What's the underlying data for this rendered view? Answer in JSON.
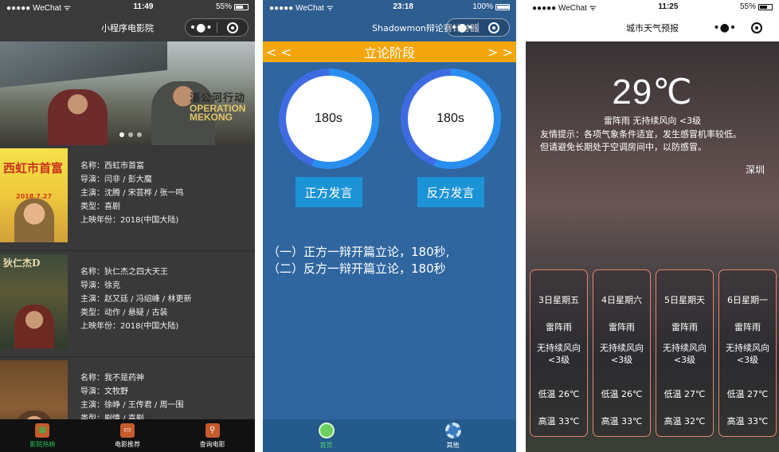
{
  "phone1": {
    "status": {
      "carrier": "●●●●● WeChat ᯤ",
      "time": "11:49",
      "battery": "55%"
    },
    "nav_title": "小程序电影院",
    "banner": {
      "title_cn": "湄公河行动",
      "title_en": "OPERATION MEKONG"
    },
    "movies": [
      {
        "poster_title": "西虹市首富",
        "poster_date": "2018.7.27",
        "name": "名称：西虹市首富",
        "director": "导演：闫非 / 彭大魔",
        "cast": "主演：沈腾 / 宋芸桦 / 张一鸣",
        "genre": "类型：喜剧",
        "year": "上映年份：2018(中国大陆)"
      },
      {
        "poster_title": "狄仁杰D",
        "poster_date": "",
        "name": "名称：狄仁杰之四大天王",
        "director": "导演：徐克",
        "cast": "主演：赵又廷 / 冯绍峰 / 林更新",
        "genre": "类型：动作 / 悬疑 / 古装",
        "year": "上映年份：2018(中国大陆)"
      },
      {
        "poster_title": "",
        "poster_date": "",
        "name": "名称：我不是药神",
        "director": "导演：文牧野",
        "cast": "主演：徐峥 / 王传君 / 周一围",
        "genre": "类型：剧情 / 喜剧",
        "year": ""
      }
    ],
    "tabs": [
      "影院热映",
      "电影推荐",
      "查询电影"
    ]
  },
  "phone2": {
    "status": {
      "carrier": "●●●●● WeChat ᯤ",
      "time": "23:18",
      "battery": "100%"
    },
    "nav_title": "Shadowmon辩论赛计时器",
    "stage": {
      "prev": "< <",
      "title": "立论阶段",
      "next": "> >"
    },
    "timers": [
      {
        "value": "180s",
        "button": "正方发言"
      },
      {
        "value": "180s",
        "button": "反方发言"
      }
    ],
    "rules": [
      "（一）正方一辩开篇立论，180秒,",
      "（二）反方一辩开篇立论，180秒"
    ],
    "tabs": [
      "首页",
      "其他"
    ]
  },
  "phone3": {
    "status": {
      "carrier": "●●●●● WeChat ᯤ",
      "time": "11:25",
      "battery": "55%"
    },
    "nav_title": "城市天气预报",
    "temperature": "29℃",
    "now": "雷阵雨 无持续风向 <3级",
    "tip_line1": "友情提示：各项气象条件适宜，发生感冒机率较低。",
    "tip_line2": "但请避免长期处于空调房间中，以防感冒。",
    "city": "深圳",
    "forecast": [
      {
        "day": "3日星期五",
        "weather": "雷阵雨",
        "wind1": "无持续风向",
        "wind2": "<3级",
        "low": "低温 26℃",
        "high": "高温 33℃"
      },
      {
        "day": "4日星期六",
        "weather": "雷阵雨",
        "wind1": "无持续风向",
        "wind2": "<3级",
        "low": "低温 26℃",
        "high": "高温 33℃"
      },
      {
        "day": "5日星期天",
        "weather": "雷阵雨",
        "wind1": "无持续风向",
        "wind2": "<3级",
        "low": "低温 27℃",
        "high": "高温 32℃"
      },
      {
        "day": "6日星期一",
        "weather": "雷阵雨",
        "wind1": "无持续风向",
        "wind2": "<3级",
        "low": "低温 27℃",
        "high": "高温 33℃"
      }
    ]
  },
  "colors": {
    "accent_orange": "#f5a60d",
    "timer_blue": "#2a8ef0",
    "button_blue": "#1c93d6",
    "active_green": "#26c55a",
    "forecast_border": "#e2876c"
  }
}
